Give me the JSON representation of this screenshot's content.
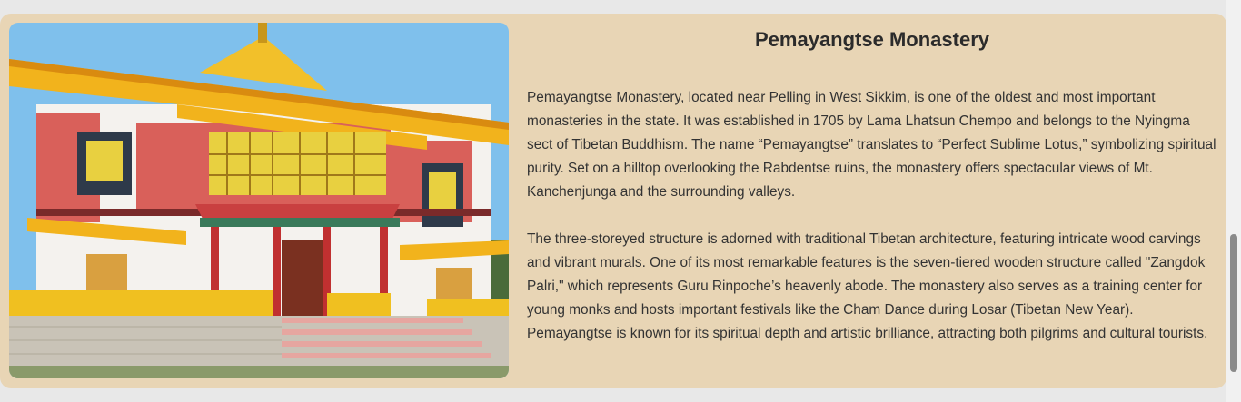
{
  "article": {
    "title": "Pemayangtse Monastery",
    "paragraph_1": "Pemayangtse Monastery, located near Pelling in West Sikkim, is one of the oldest and most important monasteries in the state. It was established in 1705 by Lama Lhatsun Chempo and belongs to the Nyingma sect of Tibetan Buddhism. The name “Pemayangtse” translates to “Perfect Sublime Lotus,” symbolizing spiritual purity. Set on a hilltop overlooking the Rabdentse ruins, the monastery offers spectacular views of Mt. Kanchenjunga and the surrounding valleys.",
    "paragraph_2": "The three-storeyed structure is adorned with traditional Tibetan architecture, featuring intricate wood carvings and vibrant murals. One of its most remarkable features is the seven-tiered wooden structure called \"Zangdok Palri,\" which represents Guru Rinpoche’s heavenly abode. The monastery also serves as a training center for young monks and hosts important festivals like the Cham Dance during Losar (Tibetan New Year). Pemayangtse is known for its spiritual depth and artistic brilliance, attracting both pilgrims and cultural tourists."
  },
  "colors": {
    "page_background": "#e8e8e8",
    "card_background": "#e8d5b5",
    "title_text": "#2b2b2b",
    "body_text": "#333333"
  }
}
